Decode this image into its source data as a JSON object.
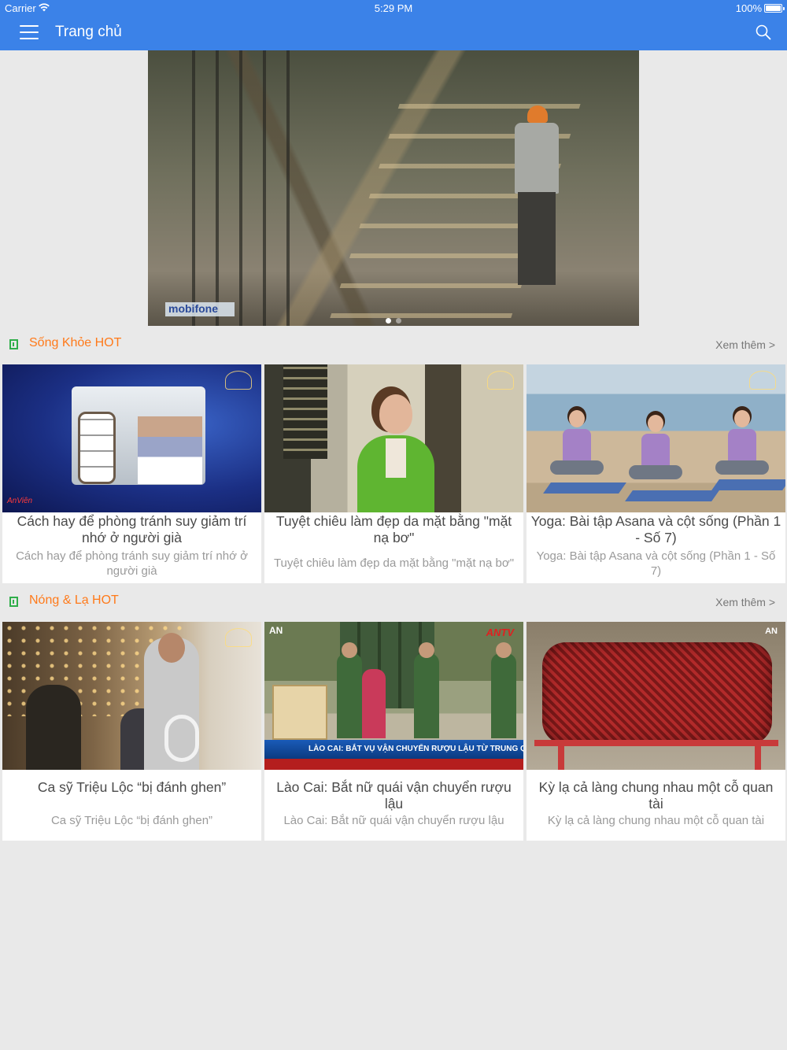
{
  "status_bar": {
    "carrier": "Carrier",
    "time": "5:29 PM",
    "battery": "100%"
  },
  "nav": {
    "title": "Trang chủ",
    "menu_icon": "hamburger-menu-icon",
    "search_icon": "search-icon"
  },
  "banner": {
    "logo_text": "mobifone",
    "page_count": 2,
    "active_page": 0
  },
  "sections": [
    {
      "title": "Sống Khỏe HOT",
      "more": "Xem thêm >",
      "items": [
        {
          "title": "Cách hay để phòng tránh suy giảm trí nhớ ở người già",
          "subtitle": "Cách hay để phòng tránh suy giảm trí nhớ ở người già"
        },
        {
          "title": "Tuyệt chiêu làm đẹp da mặt bằng \"mặt nạ bơ\"",
          "subtitle": "Tuyệt chiêu làm đẹp da mặt bằng \"mặt nạ bơ\""
        },
        {
          "title": "Yoga: Bài tập Asana và cột sống (Phần 1 - Số 7)",
          "subtitle": "Yoga: Bài tập Asana và cột sống (Phần 1 - Số 7)"
        }
      ]
    },
    {
      "title": "Nóng & Lạ HOT",
      "more": "Xem thêm >",
      "items": [
        {
          "title": "Ca sỹ Triệu Lộc “bị đánh ghen”",
          "subtitle": "Ca sỹ Triệu Lộc “bị đánh ghen”"
        },
        {
          "title": "Lào Cai: Bắt nữ quái vận chuyển rượu lậu",
          "subtitle": "Lào Cai: Bắt nữ quái vận chuyển rượu lậu",
          "thumb_ticker": "LÀO CAI: BẮT VỤ VẬN CHUYỂN RƯỢU LẬU TỪ TRUNG QUỐC",
          "thumb_channel": "ANTV"
        },
        {
          "title": "Kỳ lạ cả làng chung nhau một cỗ quan tài",
          "subtitle": "Kỳ lạ cả làng chung nhau một cỗ quan tài"
        }
      ]
    }
  ],
  "colors": {
    "nav_bg": "#3b82e8",
    "section_title": "#ff7a1a",
    "section_icon": "#2fae4a",
    "page_bg": "#e9e9e9"
  }
}
